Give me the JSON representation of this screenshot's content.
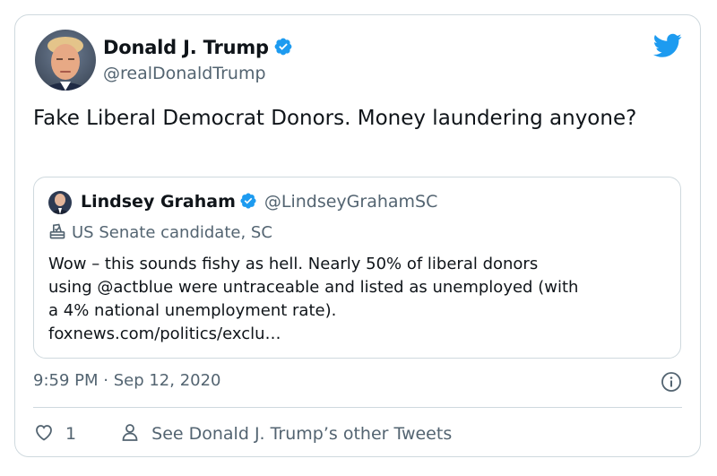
{
  "tweet": {
    "author_name": "Donald J. Trump",
    "author_handle": "@realDonaldTrump",
    "text": "Fake Liberal Democrat Donors. Money laundering anyone?",
    "timestamp": "9:59 PM · Sep 12, 2020",
    "like_count": "1",
    "other_tweets_label": "See Donald J. Trump’s other Tweets"
  },
  "quoted": {
    "author_name": "Lindsey Graham",
    "author_handle": "@LindseyGrahamSC",
    "label": "US Senate candidate, SC",
    "text_lines": [
      "Wow – this sounds fishy as hell. Nearly 50% of liberal donors",
      "using @actblue were untraceable and listed as unemployed (with",
      "a 4% national unemployment rate).",
      "foxnews.com/politics/exclu…"
    ]
  },
  "colors": {
    "brand": "#1d9bf0",
    "text": "#0f1419",
    "secondary": "#536471",
    "border": "#cfd9de"
  },
  "icons": [
    "twitter-bird-icon",
    "verified-badge-icon",
    "ballot-box-icon",
    "info-icon",
    "heart-icon",
    "person-icon"
  ]
}
